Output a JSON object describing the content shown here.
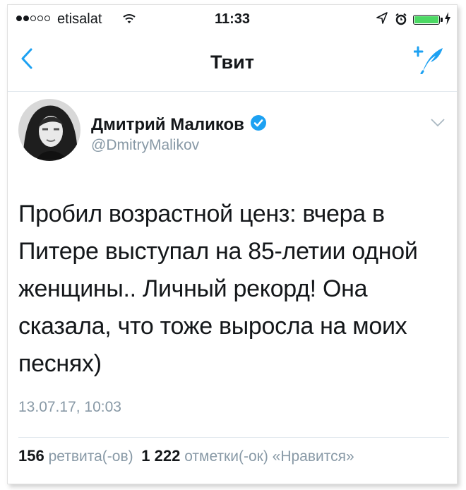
{
  "status_bar": {
    "carrier": "etisalat",
    "time": "11:33",
    "battery_level": 1.0,
    "icons": [
      "signal-dots",
      "wifi-icon",
      "location-arrow-icon",
      "alarm-icon",
      "battery-icon",
      "charging-bolt-icon"
    ]
  },
  "nav": {
    "back_icon": "chevron-left-icon",
    "title": "Твит",
    "compose_icon": "compose-tweet-icon"
  },
  "tweet": {
    "author_name": "Дмитрий Маликов",
    "handle": "@DmitryMalikov",
    "verified": true,
    "text": "Пробил возрастной ценз: вчера в Питере выступал на 85-летии одной женщины.. Личный рекорд! Она сказала, что тоже выросла на моих песнях)",
    "timestamp": "13.07.17, 10:03",
    "retweets_count": "156",
    "retweets_label": "ретвита(-ов)",
    "likes_count": "1 222",
    "likes_label": "отметки(-ок) «Нравится»"
  },
  "colors": {
    "accent": "#1da1f2",
    "muted": "#8899a6",
    "text": "#14171a",
    "battery": "#4cd964"
  }
}
